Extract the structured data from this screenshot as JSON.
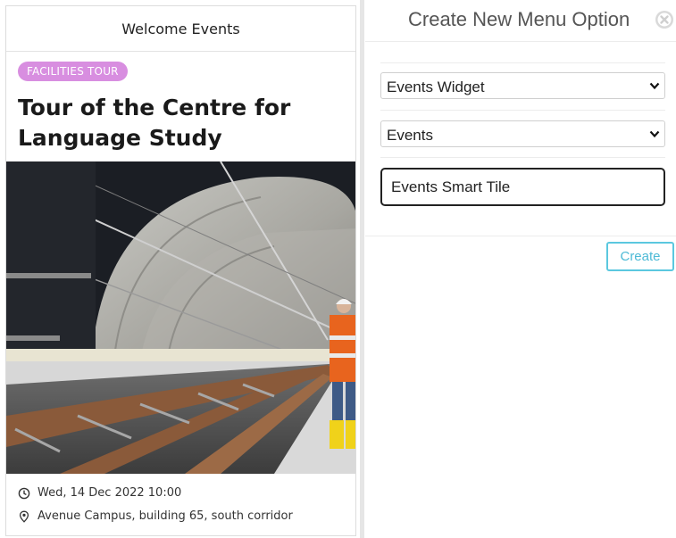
{
  "event_card": {
    "header_title": "Welcome Events",
    "category_badge": "FACILITIES TOUR",
    "title": "Tour of the Centre for Language Study",
    "date": "Wed, 14 Dec 2022 10:00",
    "location": "Avenue Campus, building 65, south corridor",
    "icons": {
      "date": "clock-icon",
      "location": "map-pin-icon"
    },
    "colors": {
      "badge": "#d88ee0"
    }
  },
  "menu_panel": {
    "title": "Create New Menu Option",
    "close_icon": "close-circle-icon",
    "widget_select": {
      "value": "Events Widget"
    },
    "type_select": {
      "value": "Events"
    },
    "name_input": {
      "value": "Events Smart Tile"
    },
    "create_label": "Create",
    "colors": {
      "create_accent": "#5bc8df"
    }
  }
}
